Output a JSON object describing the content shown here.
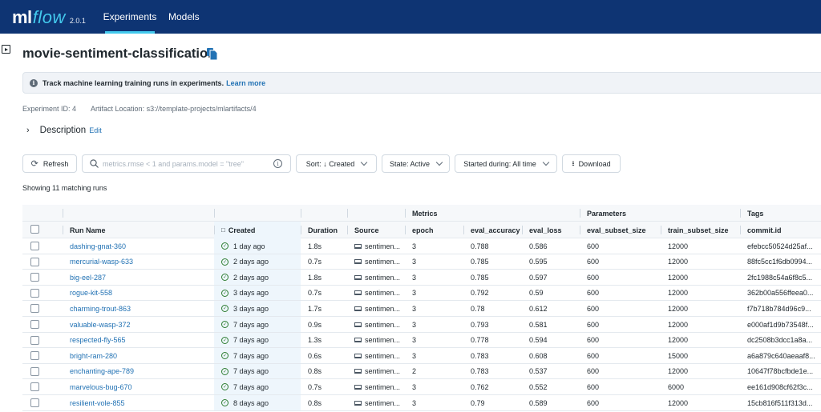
{
  "nav": {
    "logo_ml": "ml",
    "logo_flow": "flow",
    "version": "2.0.1",
    "tabs": [
      {
        "label": "Experiments",
        "active": true
      },
      {
        "label": "Models",
        "active": false
      }
    ]
  },
  "experiment": {
    "title": "movie-sentiment-classification",
    "alert_text": "Track machine learning training runs in experiments.",
    "alert_link": "Learn more",
    "id_label": "Experiment ID: 4",
    "artifact_label": "Artifact Location: s3://template-projects/mlartifacts/4",
    "description_label": "Description",
    "description_edit": "Edit"
  },
  "toolbar": {
    "refresh": "Refresh",
    "search_placeholder": "metrics.rmse < 1 and params.model = \"tree\"",
    "sort": "Sort: ↓ Created",
    "state": "State: Active",
    "started": "Started during: All time",
    "download": "Download"
  },
  "showing": "Showing 11 matching runs",
  "table": {
    "groups": {
      "metrics": "Metrics",
      "parameters": "Parameters",
      "tags": "Tags"
    },
    "columns": {
      "run_name": "Run Name",
      "created": "Created",
      "duration": "Duration",
      "source": "Source",
      "epoch": "epoch",
      "eval_accuracy": "eval_accuracy",
      "eval_loss": "eval_loss",
      "eval_subset_size": "eval_subset_size",
      "train_subset_size": "train_subset_size",
      "commit_id": "commit.id"
    },
    "rows": [
      {
        "run_name": "dashing-gnat-360",
        "created": "1 day ago",
        "duration": "1.8s",
        "source": "sentimen...",
        "epoch": "3",
        "eval_accuracy": "0.788",
        "eval_loss": "0.586",
        "eval_subset_size": "600",
        "train_subset_size": "12000",
        "commit_id": "efebcc50524d25af..."
      },
      {
        "run_name": "mercurial-wasp-633",
        "created": "2 days ago",
        "duration": "0.7s",
        "source": "sentimen...",
        "epoch": "3",
        "eval_accuracy": "0.785",
        "eval_loss": "0.595",
        "eval_subset_size": "600",
        "train_subset_size": "12000",
        "commit_id": "88fc5cc1f6db0994..."
      },
      {
        "run_name": "big-eel-287",
        "created": "2 days ago",
        "duration": "1.8s",
        "source": "sentimen...",
        "epoch": "3",
        "eval_accuracy": "0.785",
        "eval_loss": "0.597",
        "eval_subset_size": "600",
        "train_subset_size": "12000",
        "commit_id": "2fc1988c54a6f8c5..."
      },
      {
        "run_name": "rogue-kit-558",
        "created": "3 days ago",
        "duration": "0.7s",
        "source": "sentimen...",
        "epoch": "3",
        "eval_accuracy": "0.792",
        "eval_loss": "0.59",
        "eval_subset_size": "600",
        "train_subset_size": "12000",
        "commit_id": "362b00a556ffeea0..."
      },
      {
        "run_name": "charming-trout-863",
        "created": "3 days ago",
        "duration": "1.7s",
        "source": "sentimen...",
        "epoch": "3",
        "eval_accuracy": "0.78",
        "eval_loss": "0.612",
        "eval_subset_size": "600",
        "train_subset_size": "12000",
        "commit_id": "f7b718b784d96c9..."
      },
      {
        "run_name": "valuable-wasp-372",
        "created": "7 days ago",
        "duration": "0.9s",
        "source": "sentimen...",
        "epoch": "3",
        "eval_accuracy": "0.793",
        "eval_loss": "0.581",
        "eval_subset_size": "600",
        "train_subset_size": "12000",
        "commit_id": "e000af1d9b73548f..."
      },
      {
        "run_name": "respected-fly-565",
        "created": "7 days ago",
        "duration": "1.3s",
        "source": "sentimen...",
        "epoch": "3",
        "eval_accuracy": "0.778",
        "eval_loss": "0.594",
        "eval_subset_size": "600",
        "train_subset_size": "12000",
        "commit_id": "dc2508b3dcc1a8a..."
      },
      {
        "run_name": "bright-ram-280",
        "created": "7 days ago",
        "duration": "0.6s",
        "source": "sentimen...",
        "epoch": "3",
        "eval_accuracy": "0.783",
        "eval_loss": "0.608",
        "eval_subset_size": "600",
        "train_subset_size": "15000",
        "commit_id": "a6a879c640aeaaf8..."
      },
      {
        "run_name": "enchanting-ape-789",
        "created": "7 days ago",
        "duration": "0.8s",
        "source": "sentimen...",
        "epoch": "2",
        "eval_accuracy": "0.783",
        "eval_loss": "0.537",
        "eval_subset_size": "600",
        "train_subset_size": "12000",
        "commit_id": "10647f78bcfbde1e..."
      },
      {
        "run_name": "marvelous-bug-670",
        "created": "7 days ago",
        "duration": "0.7s",
        "source": "sentimen...",
        "epoch": "3",
        "eval_accuracy": "0.762",
        "eval_loss": "0.552",
        "eval_subset_size": "600",
        "train_subset_size": "6000",
        "commit_id": "ee161d908cf62f3c..."
      },
      {
        "run_name": "resilient-vole-855",
        "created": "8 days ago",
        "duration": "0.8s",
        "source": "sentimen...",
        "epoch": "3",
        "eval_accuracy": "0.79",
        "eval_loss": "0.589",
        "eval_subset_size": "600",
        "train_subset_size": "12000",
        "commit_id": "15cb816f511f313d..."
      }
    ]
  }
}
